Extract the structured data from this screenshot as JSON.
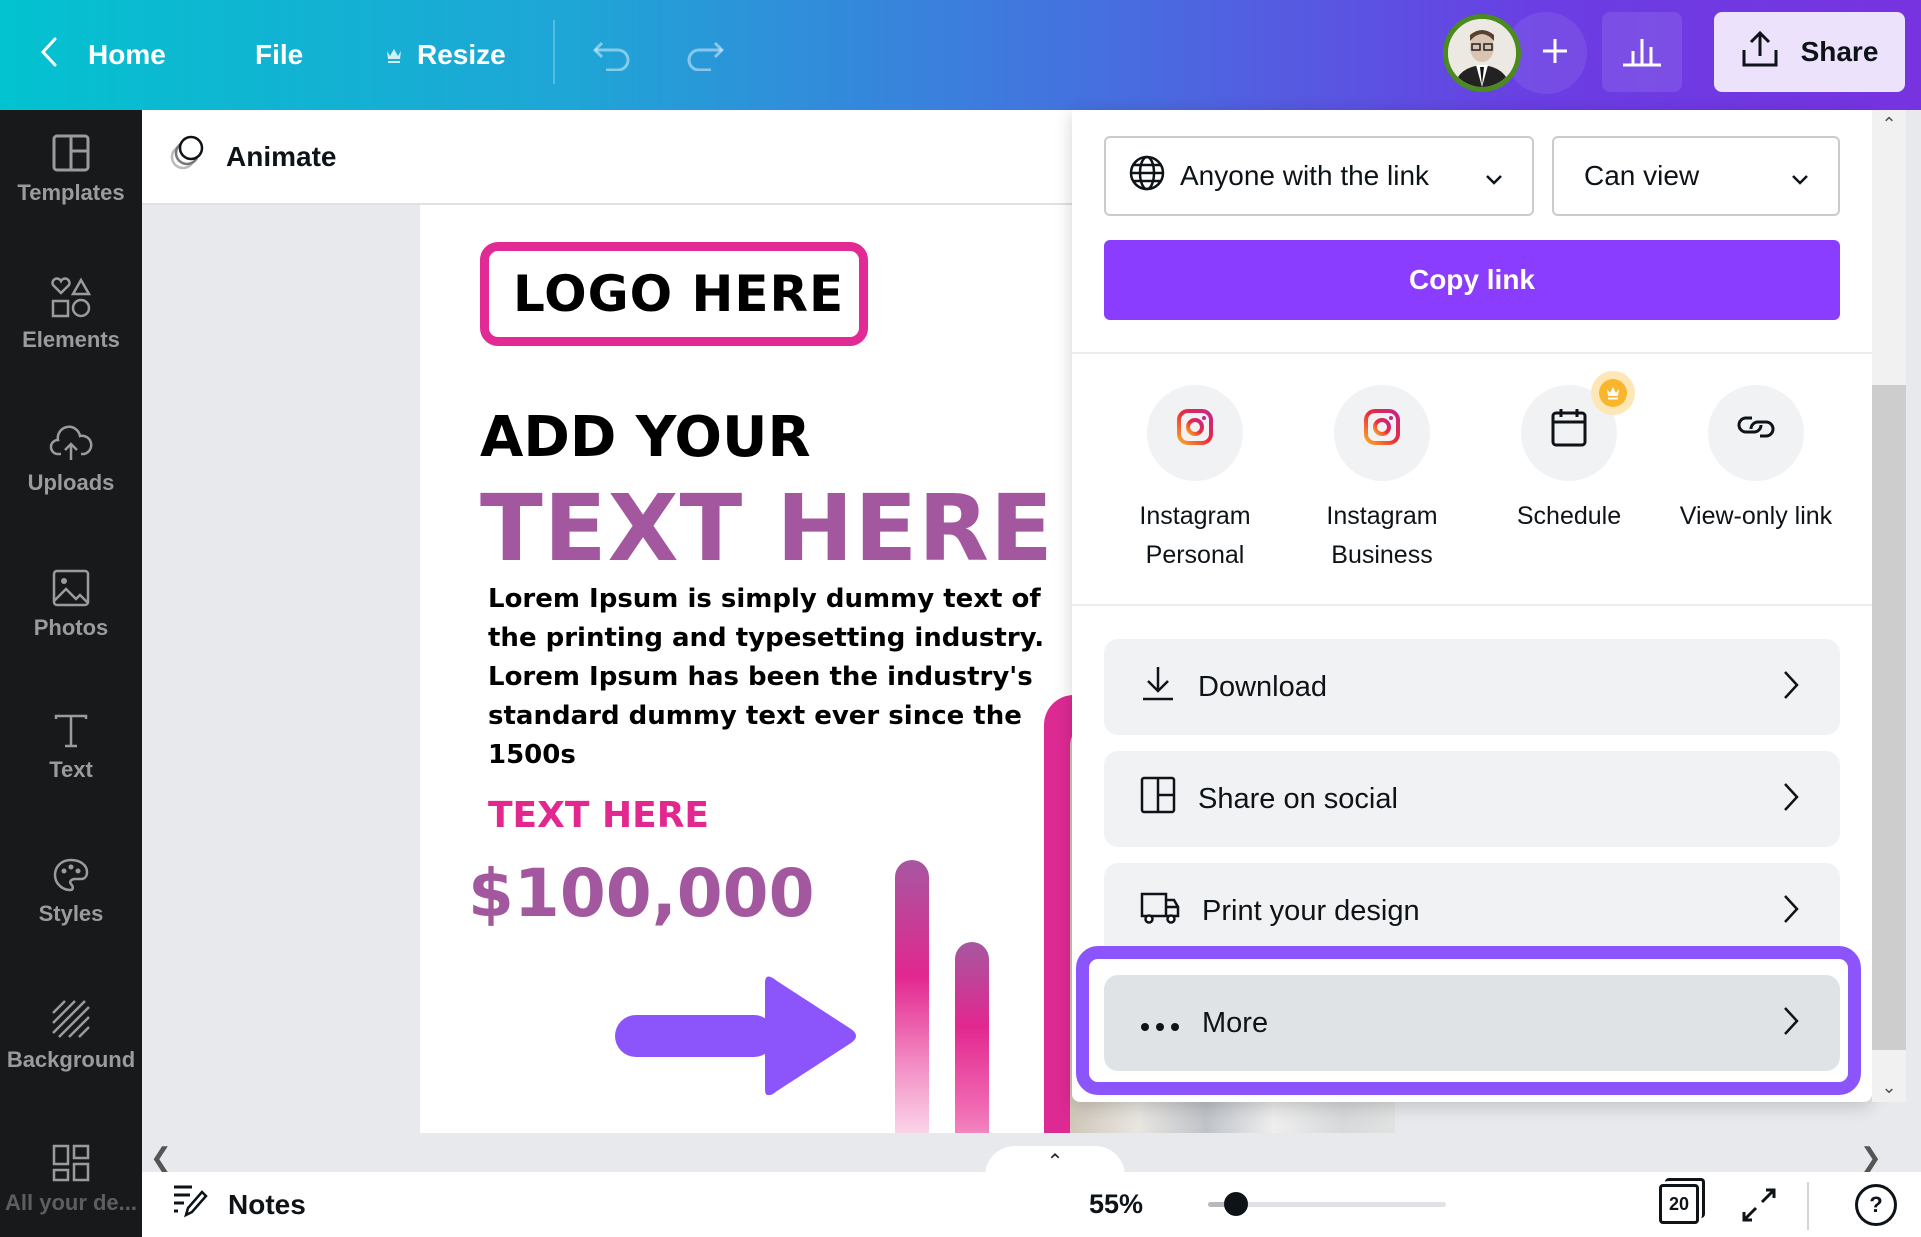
{
  "topbar": {
    "home_label": "Home",
    "file_label": "File",
    "resize_label": "Resize",
    "share_label": "Share",
    "icons": {
      "back": "chevron-left-icon",
      "resize_badge": "crown-icon",
      "undo": "undo-icon",
      "redo": "redo-icon",
      "add_collaborator": "plus-icon",
      "insights": "bar-chart-icon",
      "share": "upload-icon"
    },
    "colors": {
      "gradient_start": "#03c2cf",
      "gradient_end": "#7733e0"
    }
  },
  "sidebar": {
    "items": [
      {
        "label": "Templates",
        "icon": "templates-icon"
      },
      {
        "label": "Elements",
        "icon": "elements-icon"
      },
      {
        "label": "Uploads",
        "icon": "cloud-upload-icon"
      },
      {
        "label": "Photos",
        "icon": "image-icon"
      },
      {
        "label": "Text",
        "icon": "text-icon"
      },
      {
        "label": "Styles",
        "icon": "palette-icon"
      },
      {
        "label": "Background",
        "icon": "stripes-icon"
      },
      {
        "label": "All your de...",
        "icon": "grid-icon"
      }
    ]
  },
  "editor": {
    "animate_label": "Animate"
  },
  "design": {
    "logo": "LOGO HERE",
    "heading_1": "ADD YOUR",
    "heading_2": "TEXT HERE",
    "body": "Lorem Ipsum is simply dummy text of the printing and typesetting industry. Lorem Ipsum has been the industry's standard dummy text ever since the 1500s",
    "subheading": "TEXT HERE",
    "price": "$100,000",
    "colors": {
      "pink": "#e22a94",
      "purple": "#a2579e",
      "arrow": "#8c55fb"
    }
  },
  "share_panel": {
    "access_select": {
      "value": "Anyone with the link",
      "icon": "globe-icon"
    },
    "permission_select": {
      "value": "Can view"
    },
    "copy_link_label": "Copy link",
    "options": [
      {
        "line1": "Instagram",
        "line2": "Personal",
        "icon": "instagram-icon"
      },
      {
        "line1": "Instagram",
        "line2": "Business",
        "icon": "instagram-icon"
      },
      {
        "line1": "Schedule",
        "line2": "",
        "icon": "calendar-icon",
        "badge": "crown-icon"
      },
      {
        "line1": "View-only link",
        "line2": "",
        "icon": "link-icon"
      }
    ],
    "actions": [
      {
        "label": "Download",
        "icon": "download-icon"
      },
      {
        "label": "Share on social",
        "icon": "share-layout-icon"
      },
      {
        "label": "Print your design",
        "icon": "truck-icon"
      },
      {
        "label": "More",
        "icon": "ellipsis-icon",
        "highlighted": true
      }
    ],
    "colors": {
      "primary": "#8b3dff",
      "highlight": "#8c55fb"
    }
  },
  "bottombar": {
    "notes_label": "Notes",
    "zoom_percent": "55%",
    "zoom_slider_value": 0.05,
    "page_count": "20",
    "help_label": "?"
  }
}
